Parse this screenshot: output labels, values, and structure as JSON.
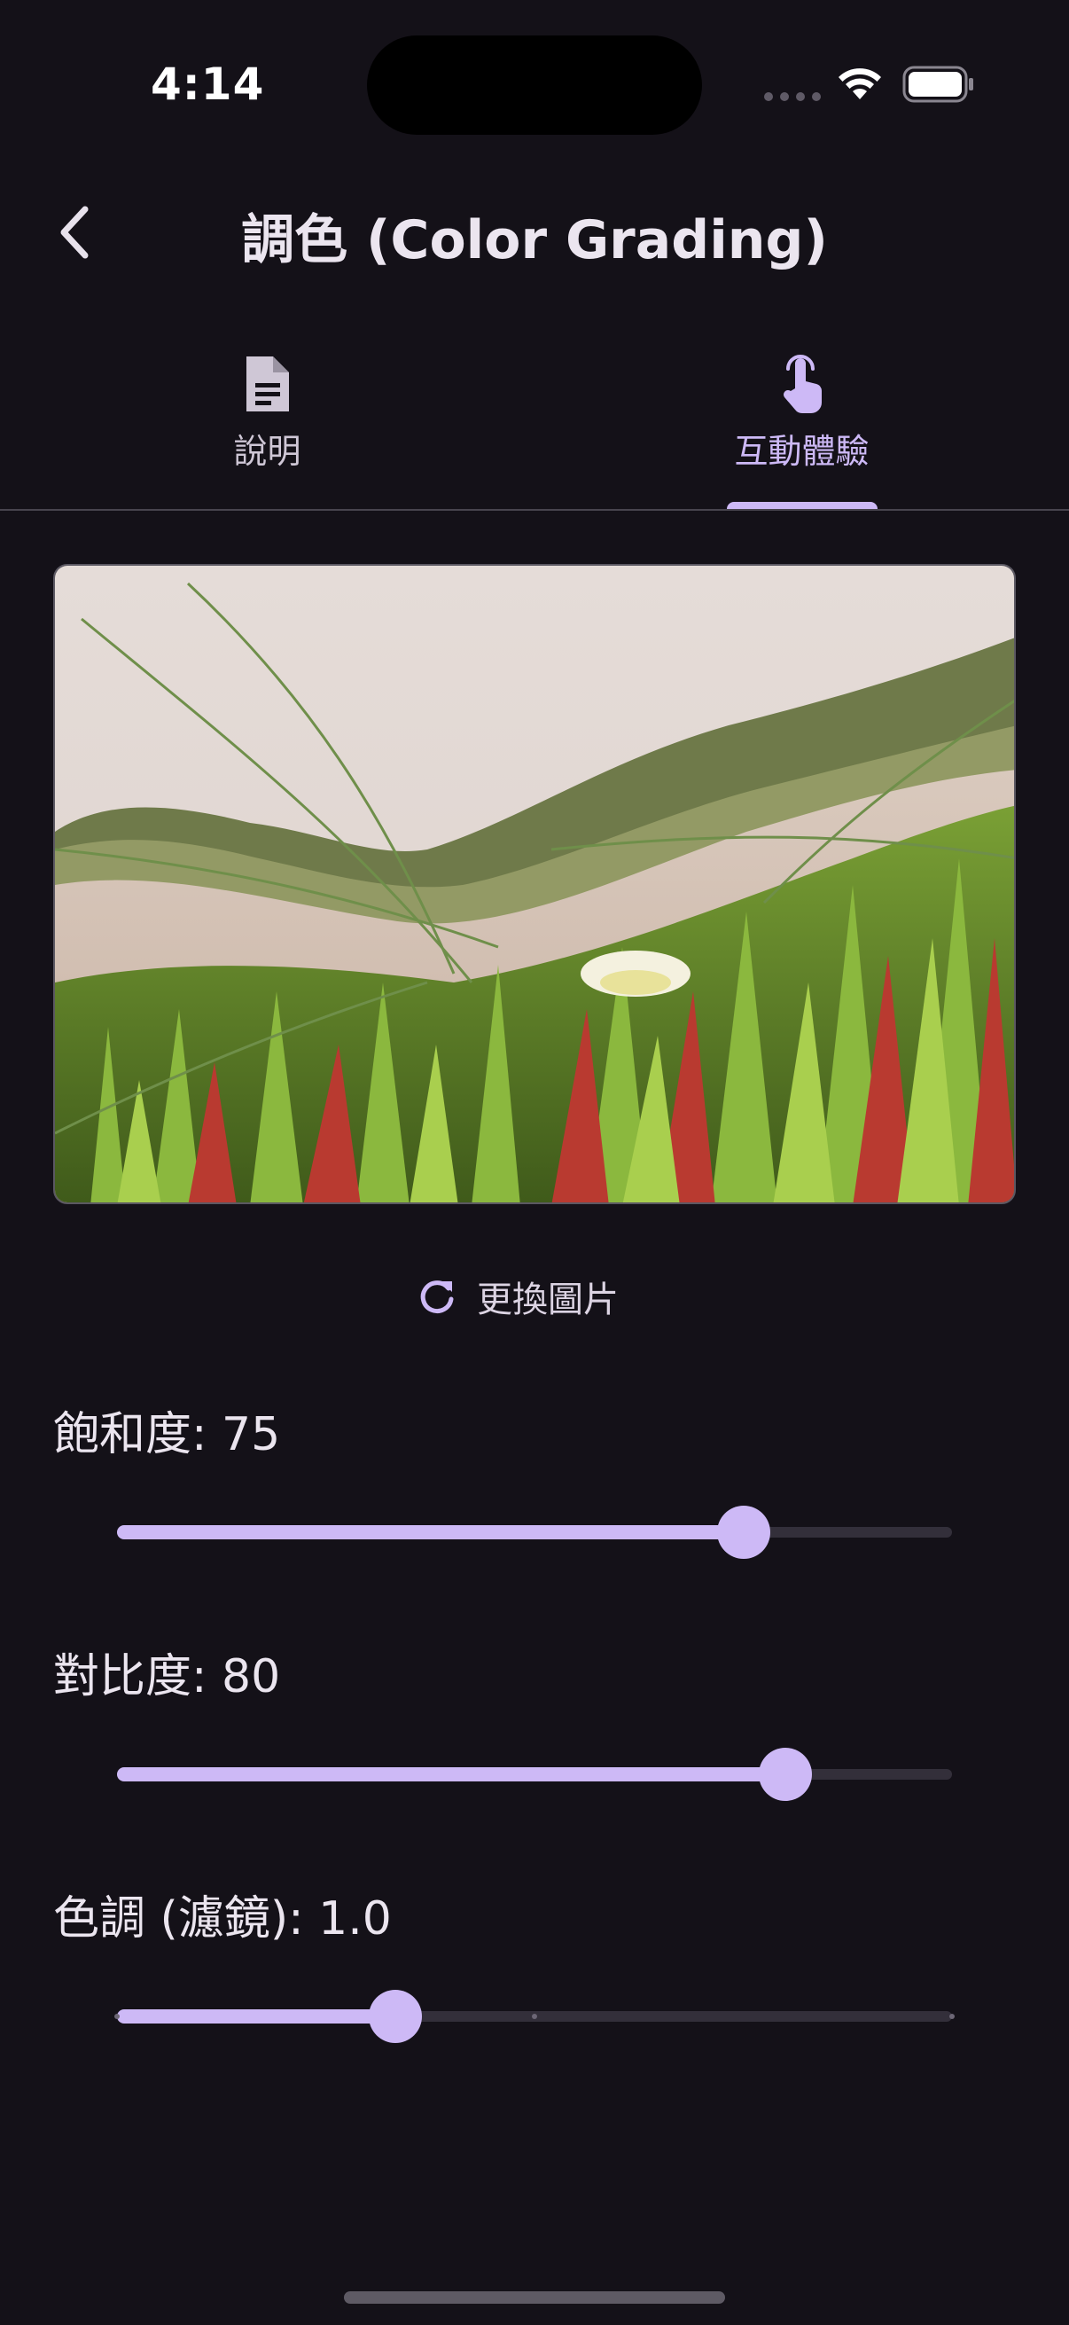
{
  "status_bar": {
    "time": "4:14"
  },
  "app_bar": {
    "title": "調色 (Color Grading)",
    "back_icon": "chevron-left-icon"
  },
  "tabs": [
    {
      "label": "說明",
      "icon": "document-icon",
      "active": false
    },
    {
      "label": "互動體驗",
      "icon": "touch-pointer-icon",
      "active": true
    }
  ],
  "change_image": {
    "label": "更換圖片",
    "icon": "refresh-icon"
  },
  "sliders": [
    {
      "label": "飽和度: 75",
      "fraction": 0.75
    },
    {
      "label": "對比度: 80",
      "fraction": 0.8
    },
    {
      "label": "色調 (濾鏡): 1.0",
      "fraction": 0.333,
      "ticks": 3
    }
  ],
  "colors": {
    "background": "#141118",
    "accent": "#cdb9f6",
    "track": "#332f3a",
    "divider": "#48444e"
  }
}
